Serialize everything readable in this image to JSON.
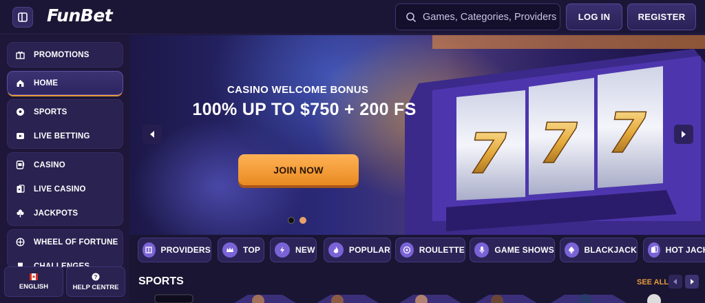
{
  "header": {
    "logo": "FunBet",
    "search_placeholder": "Games, Categories, Providers",
    "login_label": "LOG IN",
    "register_label": "REGISTER"
  },
  "sidebar": {
    "groups": [
      [
        {
          "label": "PROMOTIONS",
          "icon": "gift-icon"
        }
      ],
      [
        {
          "label": "HOME",
          "icon": "home-icon",
          "active": true
        }
      ],
      [
        {
          "label": "SPORTS",
          "icon": "soccer-ball-icon"
        },
        {
          "label": "LIVE BETTING",
          "icon": "play-icon"
        }
      ],
      [
        {
          "label": "CASINO",
          "icon": "slot-machine-icon"
        },
        {
          "label": "LIVE CASINO",
          "icon": "live-cards-icon"
        },
        {
          "label": "JACKPOTS",
          "icon": "clover-icon"
        }
      ],
      [
        {
          "label": "WHEEL OF FORTUNE",
          "icon": "wheel-icon"
        },
        {
          "label": "CHALLENGES",
          "icon": "trophy-icon"
        }
      ]
    ],
    "language_label": "ENGLISH",
    "help_label": "HELP CENTRE"
  },
  "banner": {
    "subtitle": "CASINO WELCOME BONUS",
    "title": "100% UP TO $750 + 200 FS",
    "cta": "JOIN NOW",
    "active_slide": 1,
    "slide_count": 2
  },
  "categories": [
    "PROVIDERS",
    "TOP",
    "NEW",
    "POPULAR",
    "ROULETTE",
    "GAME SHOWS",
    "BLACKJACK",
    "HOT JACKPOTS"
  ],
  "sports": {
    "title": "SPORTS",
    "see_all": "SEE ALL"
  },
  "colors": {
    "background": "#1a1533",
    "accent": "#e69b3a",
    "panel": "#2a2250"
  }
}
